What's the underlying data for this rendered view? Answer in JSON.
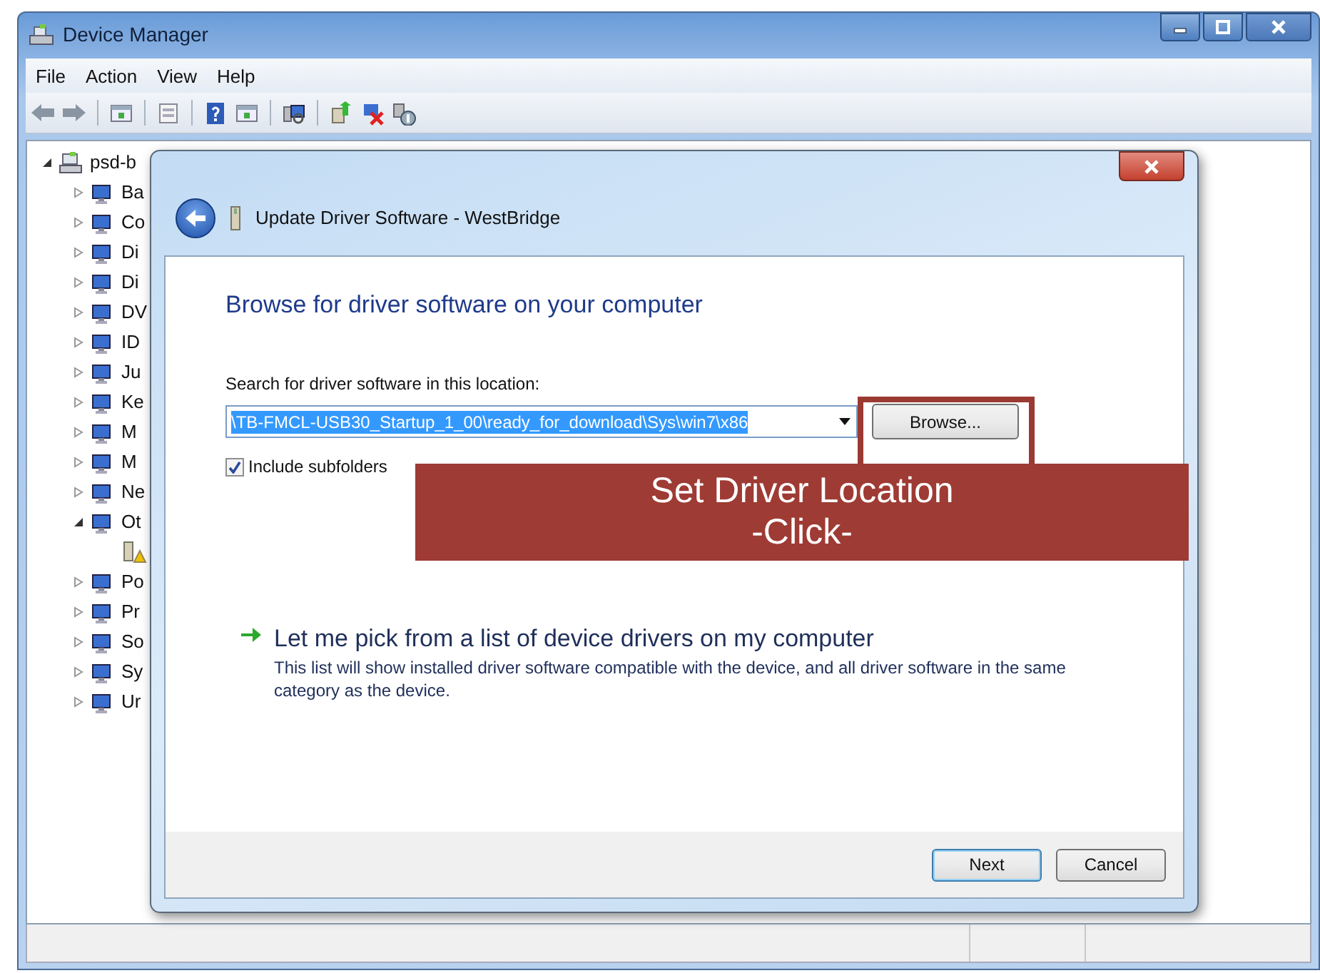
{
  "window": {
    "title": "Device Manager"
  },
  "menu": [
    "File",
    "Action",
    "View",
    "Help"
  ],
  "device_tree": [
    {
      "label": "psd-b",
      "kind": "computer",
      "expanded": true,
      "children": [
        {
          "label": "Ba",
          "kind": "device",
          "expanded": false
        },
        {
          "label": "Co",
          "kind": "device",
          "expanded": false
        },
        {
          "label": "Di",
          "kind": "device",
          "expanded": false
        },
        {
          "label": "Di",
          "kind": "device",
          "expanded": false
        },
        {
          "label": "DV",
          "kind": "device",
          "expanded": false
        },
        {
          "label": "ID",
          "kind": "device",
          "expanded": false
        },
        {
          "label": "Ju",
          "kind": "device",
          "expanded": false
        },
        {
          "label": "Ke",
          "kind": "device",
          "expanded": false
        },
        {
          "label": "M",
          "kind": "device",
          "expanded": false
        },
        {
          "label": "M",
          "kind": "device",
          "expanded": false
        },
        {
          "label": "Ne",
          "kind": "device",
          "expanded": false
        },
        {
          "label": "Ot",
          "kind": "device",
          "expanded": true,
          "children": [
            {
              "kind": "warning"
            }
          ]
        },
        {
          "label": "Po",
          "kind": "device",
          "expanded": false
        },
        {
          "label": "Pr",
          "kind": "device",
          "expanded": false
        },
        {
          "label": "So",
          "kind": "device",
          "expanded": false
        },
        {
          "label": "Sy",
          "kind": "device",
          "expanded": false
        },
        {
          "label": "Ur",
          "kind": "device",
          "expanded": false
        }
      ]
    }
  ],
  "dialog": {
    "title": "Update Driver Software - WestBridge",
    "heading": "Browse for driver software on your computer",
    "location_label": "Search for driver software in this location:",
    "location": {
      "value": "\\TB-FMCL-USB30_Startup_1_00\\ready_for_download\\Sys\\win7\\x86",
      "selected": true
    },
    "browse_button": "Browse...",
    "include_subfolders": {
      "label": "Include subfolders",
      "checked": true
    },
    "pick_option": {
      "title": "Let me pick from a list of device drivers on my computer",
      "description": "This list will show installed driver software compatible with the device, and all driver software in the same category as the device."
    },
    "buttons": [
      "Next",
      "Cancel"
    ]
  },
  "annotation": {
    "lines": [
      "Set Driver Location",
      "-Click-"
    ]
  }
}
